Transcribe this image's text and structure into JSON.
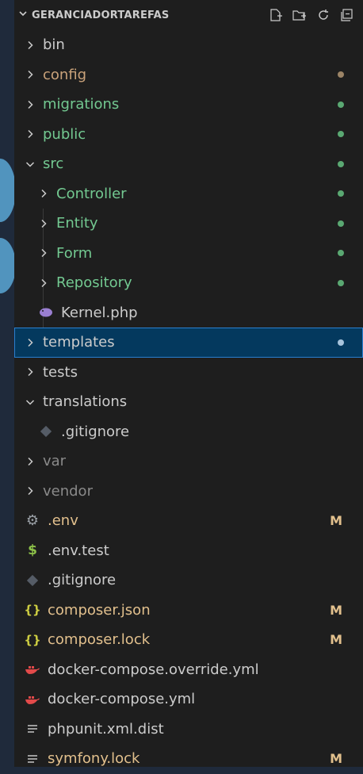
{
  "explorer": {
    "title": "GERANCIADORTAREFAS",
    "actions": [
      "new-file-icon",
      "new-folder-icon",
      "refresh-icon",
      "collapse-all-icon"
    ]
  },
  "colors": {
    "modified": "#e2c08d",
    "untracked": "#73c991",
    "ignored": "#8a8a8a",
    "selected_bg": "#04395e"
  },
  "tree": [
    {
      "name": "bin",
      "kind": "folder",
      "expanded": false,
      "depth": 0,
      "status": ""
    },
    {
      "name": "config",
      "kind": "folder",
      "expanded": false,
      "depth": 0,
      "status": "modified-dot"
    },
    {
      "name": "migrations",
      "kind": "folder",
      "expanded": false,
      "depth": 0,
      "status": "untracked-dot"
    },
    {
      "name": "public",
      "kind": "folder",
      "expanded": false,
      "depth": 0,
      "status": "untracked-dot"
    },
    {
      "name": "src",
      "kind": "folder",
      "expanded": true,
      "depth": 0,
      "status": "untracked-dot"
    },
    {
      "name": "Controller",
      "kind": "folder",
      "expanded": false,
      "depth": 1,
      "status": "untracked-dot"
    },
    {
      "name": "Entity",
      "kind": "folder",
      "expanded": false,
      "depth": 1,
      "status": "untracked-dot"
    },
    {
      "name": "Form",
      "kind": "folder",
      "expanded": false,
      "depth": 1,
      "status": "untracked-dot"
    },
    {
      "name": "Repository",
      "kind": "folder",
      "expanded": false,
      "depth": 1,
      "status": "untracked-dot"
    },
    {
      "name": "Kernel.php",
      "kind": "file",
      "icon": "php-elephant-icon",
      "depth": 1,
      "status": ""
    },
    {
      "name": "templates",
      "kind": "folder",
      "expanded": false,
      "depth": 0,
      "status": "selected-dot"
    },
    {
      "name": "tests",
      "kind": "folder",
      "expanded": false,
      "depth": 0,
      "status": ""
    },
    {
      "name": "translations",
      "kind": "folder",
      "expanded": true,
      "depth": 0,
      "status": ""
    },
    {
      "name": ".gitignore",
      "kind": "file",
      "icon": "git-icon",
      "depth": 1,
      "status": ""
    },
    {
      "name": "var",
      "kind": "folder",
      "expanded": false,
      "depth": 0,
      "status": "ignored"
    },
    {
      "name": "vendor",
      "kind": "folder",
      "expanded": false,
      "depth": 0,
      "status": "ignored"
    },
    {
      "name": ".env",
      "kind": "file",
      "icon": "gear-icon",
      "depth": 0,
      "status": "M"
    },
    {
      "name": ".env.test",
      "kind": "file",
      "icon": "dollar-icon",
      "depth": 0,
      "status": ""
    },
    {
      "name": ".gitignore",
      "kind": "file",
      "icon": "git-icon",
      "depth": 0,
      "status": ""
    },
    {
      "name": "composer.json",
      "kind": "file",
      "icon": "json-braces-icon",
      "depth": 0,
      "status": "M"
    },
    {
      "name": "composer.lock",
      "kind": "file",
      "icon": "json-braces-icon",
      "depth": 0,
      "status": "M"
    },
    {
      "name": "docker-compose.override.yml",
      "kind": "file",
      "icon": "docker-whale-icon",
      "depth": 0,
      "status": ""
    },
    {
      "name": "docker-compose.yml",
      "kind": "file",
      "icon": "docker-whale-icon",
      "depth": 0,
      "status": ""
    },
    {
      "name": "phpunit.xml.dist",
      "kind": "file",
      "icon": "lines-icon",
      "depth": 0,
      "status": ""
    },
    {
      "name": "symfony.lock",
      "kind": "file",
      "icon": "lines-icon",
      "depth": 0,
      "status": "M"
    }
  ]
}
